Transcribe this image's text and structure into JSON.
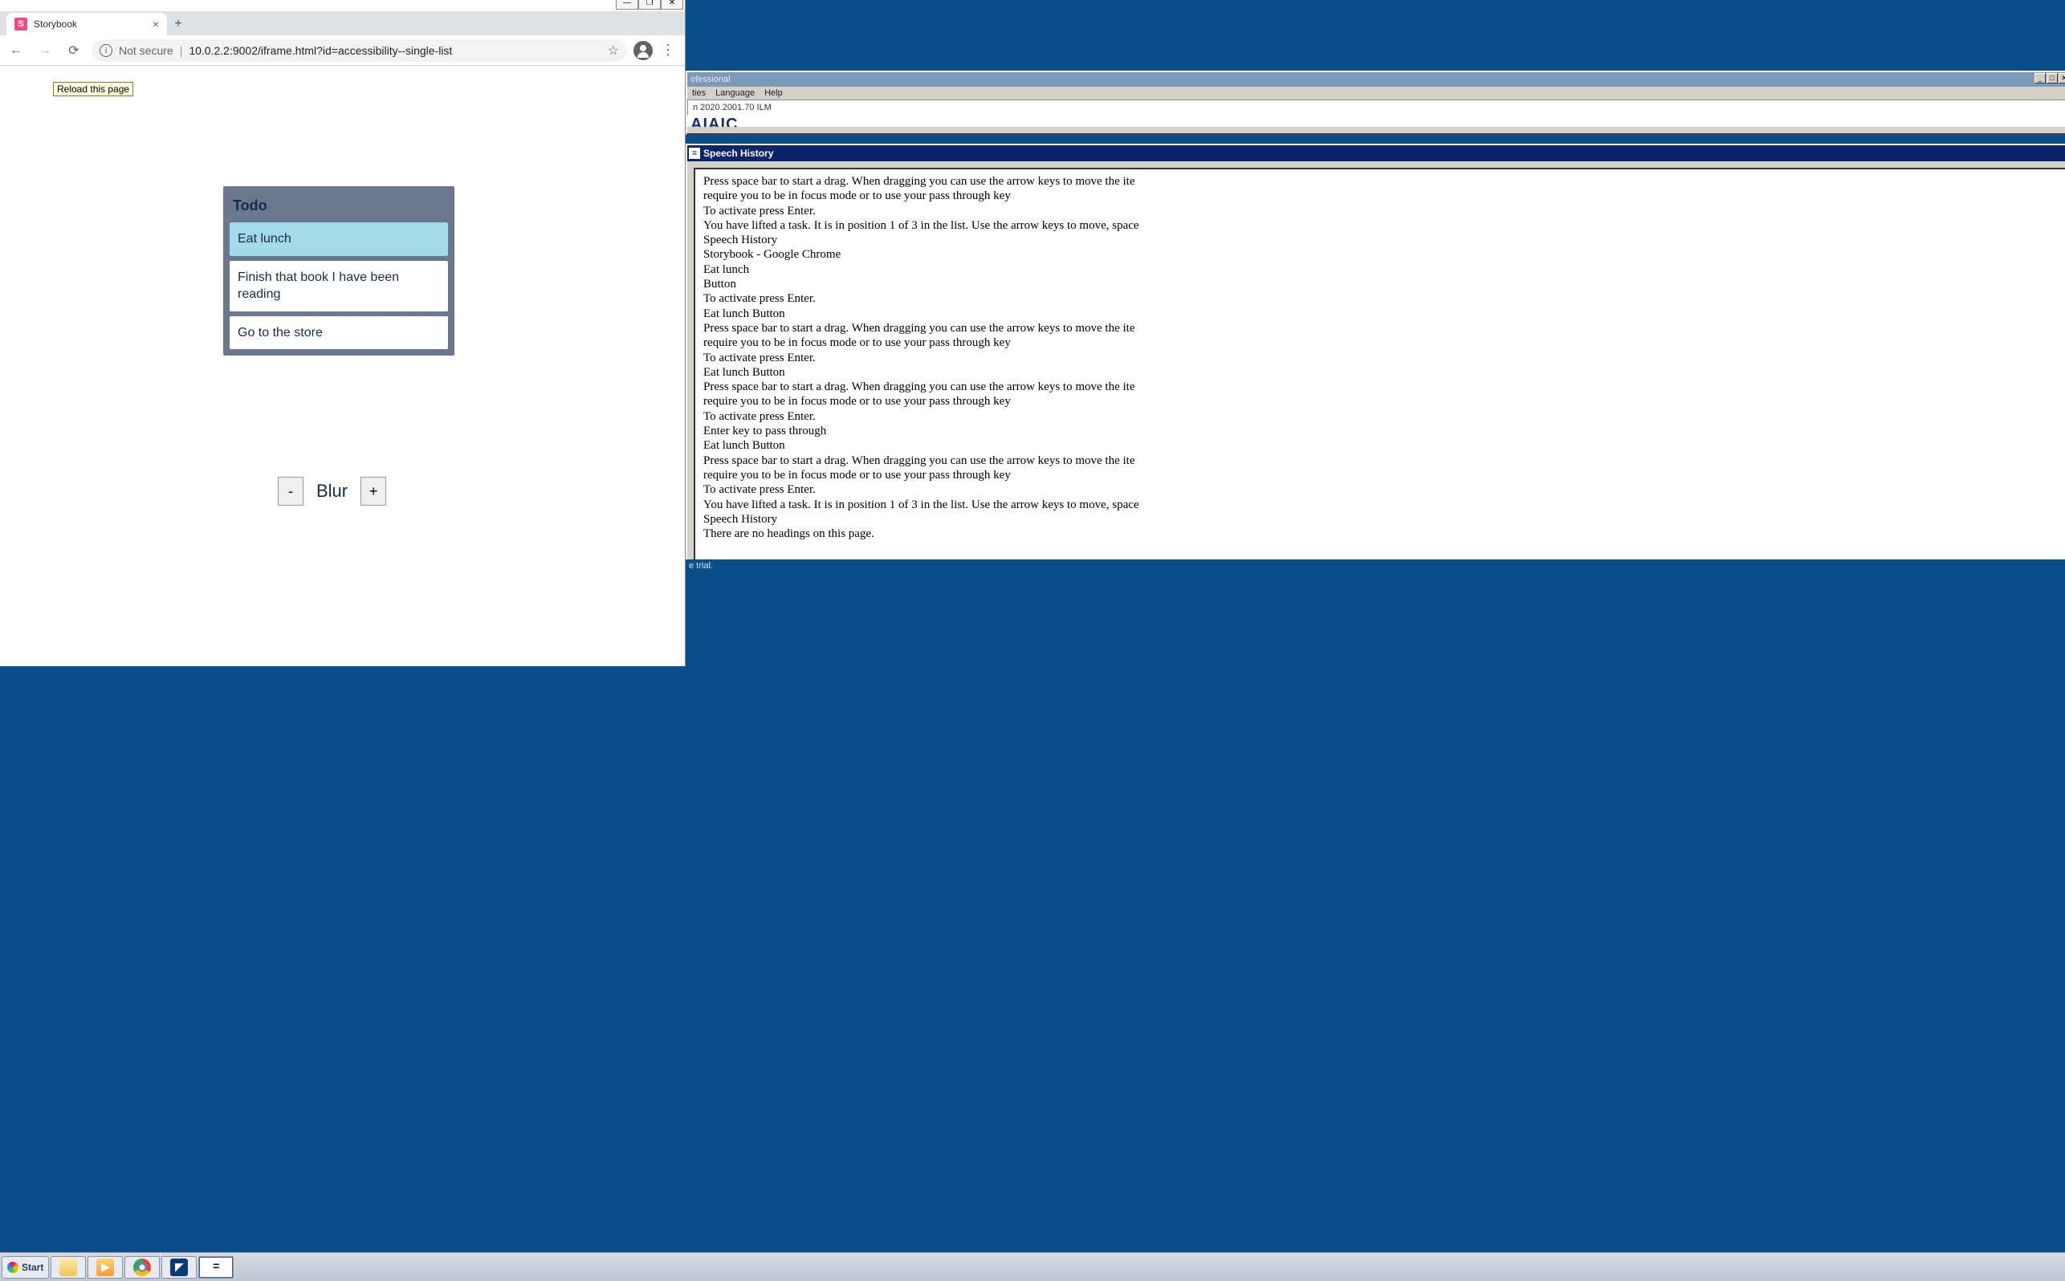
{
  "chrome": {
    "window_controls": {
      "min": "—",
      "max": "❐",
      "close": "✕"
    },
    "tab": {
      "favicon_letter": "S",
      "title": "Storybook",
      "close_glyph": "×"
    },
    "new_tab_glyph": "+",
    "nav": {
      "back": "←",
      "forward": "→",
      "reload": "⟳"
    },
    "omnibox": {
      "info_glyph": "i",
      "not_secure": "Not secure",
      "separator": "|",
      "url": "10.0.2.2:9002/iframe.html?id=accessibility--single-list",
      "star_glyph": "☆"
    },
    "kebab_glyph": "⋮",
    "tooltip_reload": "Reload this page"
  },
  "todo": {
    "title": "Todo",
    "items": [
      "Eat lunch",
      "Finish that book I have been reading",
      "Go to the store"
    ]
  },
  "blur": {
    "minus": "-",
    "label": "Blur",
    "plus": "+"
  },
  "jaws": {
    "title_fragment": "ofessional",
    "menus": [
      "ties",
      "Language",
      "Help"
    ],
    "version_fragment": "n 2020.2001.70 ILM",
    "brand_fragment": "AIAIC"
  },
  "speech": {
    "sys_glyph": "=",
    "title": "Speech History",
    "lines": [
      "Press space bar to start a drag. When dragging you can use the arrow keys to move the ite",
      "require you to be in focus mode or to use your pass through key",
      "To activate press Enter.",
      "You have lifted a task. It is in position 1 of 3 in the list. Use the arrow keys to move, space",
      "Speech History",
      "Storybook - Google Chrome",
      "Eat lunch",
      "Button",
      "To activate press Enter.",
      "Eat lunch Button",
      "Press space bar to start a drag. When dragging you can use the arrow keys to move the ite",
      "require you to be in focus mode or to use your pass through key",
      "To activate press Enter.",
      "Eat lunch Button",
      "Press space bar to start a drag. When dragging you can use the arrow keys to move the ite",
      "require you to be in focus mode or to use your pass through key",
      "To activate press Enter.",
      "Enter key to pass through",
      "Eat lunch Button",
      "Press space bar to start a drag. When dragging you can use the arrow keys to move the ite",
      "require you to be in focus mode or to use your pass through key",
      "To activate press Enter.",
      "You have lifted a task. It is in position 1 of 3 in the list. Use the arrow keys to move, space",
      "Speech History",
      "There are no headings on this page."
    ]
  },
  "trial_fragment": "e trial.",
  "taskbar": {
    "start_label": "Start",
    "wmp_glyph": "▶",
    "blue_glyph": "◤",
    "jaws_glyph": "="
  }
}
